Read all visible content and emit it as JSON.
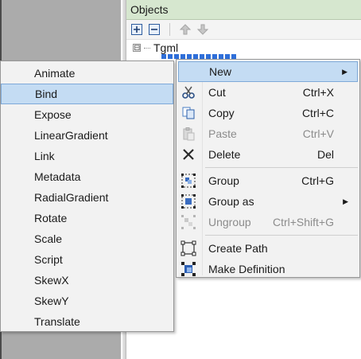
{
  "objects_panel": {
    "title": "Objects",
    "toolbar": {
      "expand_icon": "plus-box-icon",
      "collapse_icon": "minus-box-icon",
      "move_up_icon": "arrow-up-icon",
      "move_down_icon": "arrow-down-icon"
    },
    "tree": {
      "root_label": "Tgml",
      "expander": "⊟"
    }
  },
  "context_menu": {
    "items": [
      {
        "label": "New",
        "shortcut": "",
        "submenu": true,
        "disabled": false,
        "highlight": true,
        "icon": ""
      },
      {
        "label": "Cut",
        "shortcut": "Ctrl+X",
        "submenu": false,
        "disabled": false,
        "icon": "scissors-icon"
      },
      {
        "label": "Copy",
        "shortcut": "Ctrl+C",
        "submenu": false,
        "disabled": false,
        "icon": "copy-icon"
      },
      {
        "label": "Paste",
        "shortcut": "Ctrl+V",
        "submenu": false,
        "disabled": true,
        "icon": "paste-icon"
      },
      {
        "label": "Delete",
        "shortcut": "Del",
        "submenu": false,
        "disabled": false,
        "icon": "delete-x-icon"
      },
      {
        "label": "Group",
        "shortcut": "Ctrl+G",
        "submenu": false,
        "disabled": false,
        "icon": "group-icon"
      },
      {
        "label": "Group as",
        "shortcut": "",
        "submenu": true,
        "disabled": false,
        "icon": "group-as-icon"
      },
      {
        "label": "Ungroup",
        "shortcut": "Ctrl+Shift+G",
        "submenu": false,
        "disabled": true,
        "icon": "ungroup-icon"
      },
      {
        "label": "Create Path",
        "shortcut": "",
        "submenu": false,
        "disabled": false,
        "icon": "create-path-icon"
      },
      {
        "label": "Make Definition",
        "shortcut": "",
        "submenu": false,
        "disabled": false,
        "icon": "make-definition-icon"
      }
    ],
    "arrow_glyph": "▶"
  },
  "new_submenu": {
    "highlighted": "Bind",
    "items": [
      "Animate",
      "Bind",
      "Expose",
      "LinearGradient",
      "Link",
      "Metadata",
      "RadialGradient",
      "Rotate",
      "Scale",
      "Script",
      "SkewX",
      "SkewY",
      "Translate"
    ]
  },
  "colors": {
    "panel_header_bg": "#d6e7cf",
    "menu_bg": "#f2f2f2",
    "highlight_bg": "#c4dcf3",
    "highlight_border": "#7ea9d8",
    "canvas_gray": "#ababab"
  }
}
